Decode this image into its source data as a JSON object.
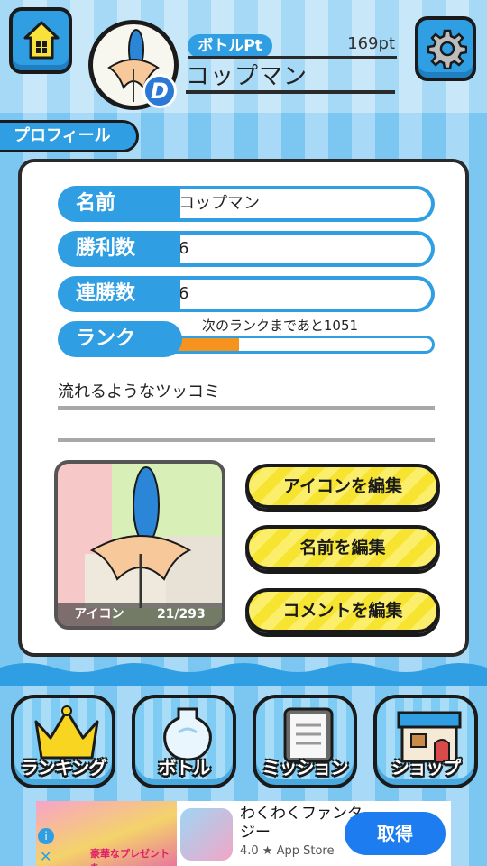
{
  "header": {
    "pt_label": "ボトルPt",
    "pt_value": "169pt",
    "user_name": "コップマン",
    "badge_letter": "D"
  },
  "profile_tab": {
    "label": "プロフィール"
  },
  "profile": {
    "rows": [
      {
        "label": "名前",
        "value": "コップマン"
      },
      {
        "label": "勝利数",
        "value": "6"
      },
      {
        "label": "連勝数",
        "value": "6"
      }
    ],
    "rank": {
      "label": "ランク",
      "note": "次のランクまであと1051",
      "progress_percent": 25
    },
    "comment": "流れるようなツッコミ"
  },
  "icon_box": {
    "caption_label": "アイコン",
    "caption_count": "21/293"
  },
  "edit_buttons": {
    "edit_icon": "アイコンを編集",
    "edit_name": "名前を編集",
    "edit_comment": "コメントを編集"
  },
  "nav": {
    "ranking": "ランキング",
    "bottle": "ボトル",
    "mission": "ミッション",
    "shop": "ショップ"
  },
  "ad": {
    "banner_text": "豪華なプレゼントを",
    "title": "わくわくファンタジー",
    "subtitle": "4.0 ★ App Store",
    "cta": "取得"
  },
  "colors": {
    "primary_blue": "#2f9ee3",
    "button_yellow": "#f6e430",
    "progress_orange": "#f6921e"
  }
}
